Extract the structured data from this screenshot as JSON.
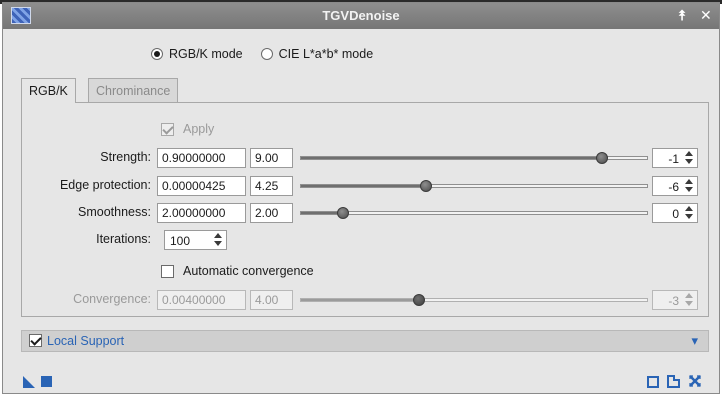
{
  "window": {
    "title": "TGVDenoise"
  },
  "titlebar": {
    "shade_glyph": "⯭",
    "close_glyph": "✕"
  },
  "modes": {
    "options": [
      {
        "label": "RGB/K mode",
        "selected": true
      },
      {
        "label": "CIE L*a*b* mode",
        "selected": false
      }
    ]
  },
  "tabs": [
    {
      "label": "RGB/K",
      "active": true
    },
    {
      "label": "Chrominance",
      "active": false
    }
  ],
  "apply": {
    "label": "Apply",
    "checked": true,
    "enabled": false
  },
  "params": [
    {
      "label": "Strength:",
      "value": "0.90000000",
      "mantissa": "9.00",
      "slider_fraction": 0.87,
      "exponent": "-1",
      "enabled": true
    },
    {
      "label": "Edge protection:",
      "value": "0.00000425",
      "mantissa": "4.25",
      "slider_fraction": 0.36,
      "exponent": "-6",
      "enabled": true
    },
    {
      "label": "Smoothness:",
      "value": "2.00000000",
      "mantissa": "2.00",
      "slider_fraction": 0.12,
      "exponent": "0",
      "enabled": true
    }
  ],
  "iterations": {
    "label": "Iterations:",
    "value": "100"
  },
  "auto_convergence": {
    "label": "Automatic convergence",
    "checked": false
  },
  "convergence": {
    "label": "Convergence:",
    "value": "0.00400000",
    "mantissa": "4.00",
    "slider_fraction": 0.34,
    "exponent": "-3",
    "enabled": false
  },
  "local_support": {
    "label": "Local Support",
    "checked": true,
    "expand_glyph": "▾"
  },
  "bottom": {
    "icons": [
      "new-instance-icon",
      "apply-icon",
      "reset-icon",
      "preview-icon",
      "close-icon"
    ],
    "glyphs": {
      "reset": "☐",
      "preview": "⎘",
      "close": "✕"
    }
  },
  "colors": {
    "accent": "#2a64b5",
    "titlebar": "#7f7f7f",
    "background": "#e6e6e6"
  }
}
